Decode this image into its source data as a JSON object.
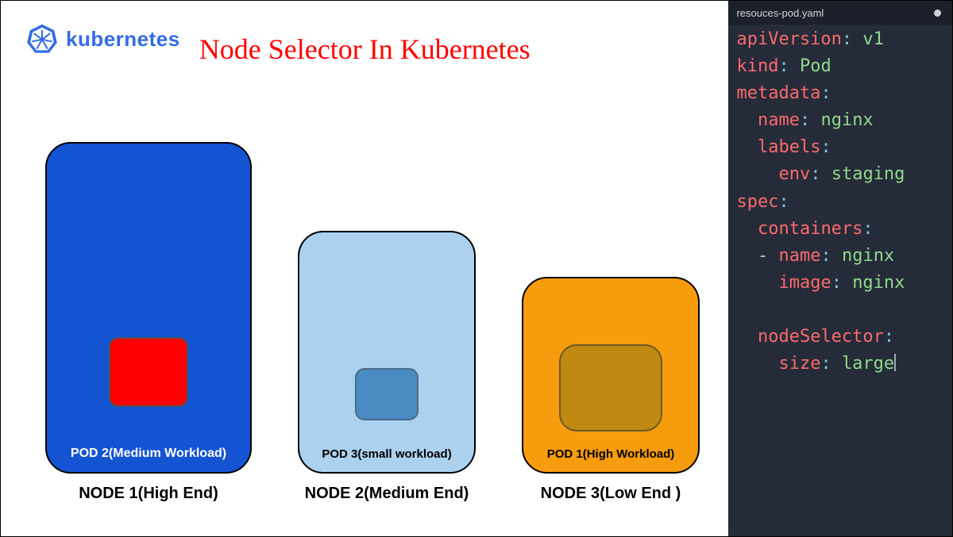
{
  "logo": {
    "text": "kubernetes"
  },
  "title": "Node Selector In Kubernetes",
  "nodes": [
    {
      "label": "NODE 1(High End)",
      "pod_label": "POD 2(Medium Workload)"
    },
    {
      "label": "NODE 2(Medium End)",
      "pod_label": "POD 3(small workload)"
    },
    {
      "label": "NODE 3(Low End )",
      "pod_label": "POD 1(High Workload)"
    }
  ],
  "editor": {
    "tab_name": "resouces-pod.yaml",
    "yaml": {
      "apiVersion": "v1",
      "kind": "Pod",
      "metadata_key": "metadata",
      "name_key": "name",
      "name_val": "nginx",
      "labels_key": "labels",
      "env_key": "env",
      "env_val": "staging",
      "spec_key": "spec",
      "containers_key": "containers",
      "c_name_key": "name",
      "c_name_val": "nginx",
      "c_image_key": "image",
      "c_image_val": "nginx",
      "nodeSelector_key": "nodeSelector",
      "size_key": "size",
      "size_val": "large"
    }
  }
}
